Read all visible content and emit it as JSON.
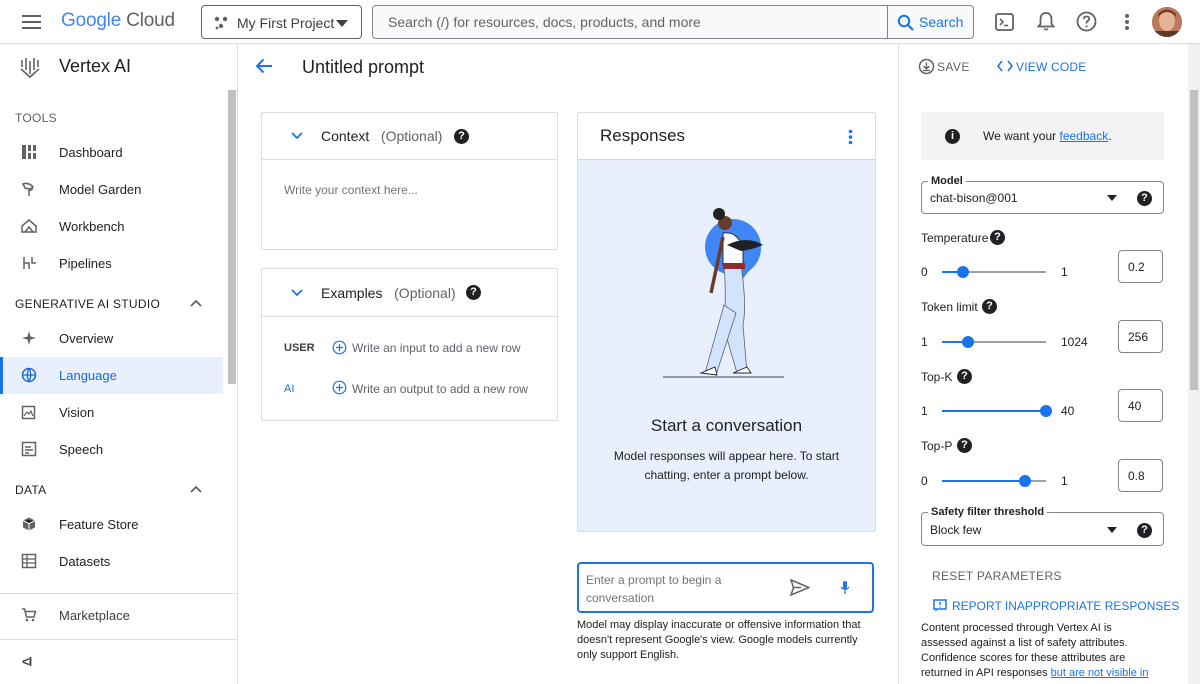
{
  "topbar": {
    "logo_google": "Google",
    "logo_cloud": "Cloud",
    "project": "My First Project",
    "search_placeholder": "Search (/) for resources, docs, products, and more",
    "search_button": "Search"
  },
  "nav": {
    "product": "Vertex AI",
    "tools_header": "TOOLS",
    "tools": [
      {
        "label": "Dashboard",
        "icon": "dashboard-icon"
      },
      {
        "label": "Model Garden",
        "icon": "model-garden-icon"
      },
      {
        "label": "Workbench",
        "icon": "workbench-icon"
      },
      {
        "label": "Pipelines",
        "icon": "pipelines-icon"
      }
    ],
    "genai_header": "GENERATIVE AI STUDIO",
    "genai": [
      {
        "label": "Overview",
        "icon": "sparkle-icon"
      },
      {
        "label": "Language",
        "icon": "language-icon",
        "active": true
      },
      {
        "label": "Vision",
        "icon": "vision-icon"
      },
      {
        "label": "Speech",
        "icon": "speech-icon"
      }
    ],
    "data_header": "DATA",
    "data": [
      {
        "label": "Feature Store",
        "icon": "feature-store-icon"
      },
      {
        "label": "Datasets",
        "icon": "datasets-icon"
      }
    ],
    "marketplace": "Marketplace",
    "collapse_glyph": "<I"
  },
  "main": {
    "title": "Untitled prompt",
    "context": {
      "title": "Context",
      "optional": "(Optional)",
      "placeholder": "Write your context here..."
    },
    "examples": {
      "title": "Examples",
      "optional": "(Optional)",
      "user_label": "USER",
      "user_placeholder": "Write an input to add a new row",
      "ai_label": "AI",
      "ai_placeholder": "Write an output to add a new row"
    },
    "responses": {
      "title": "Responses",
      "empty_title": "Start a conversation",
      "empty_text": "Model responses will appear here. To start chatting, enter a prompt below."
    },
    "prompt": {
      "placeholder": "Enter a prompt to begin a conversation",
      "disclaimer": "Model may display inaccurate or offensive information that doesn't represent Google's view. Google models currently only support English."
    }
  },
  "panel": {
    "save": "SAVE",
    "view_code": "VIEW CODE",
    "feedback_prefix": "We want your ",
    "feedback_link": "feedback",
    "feedback_suffix": ".",
    "model_label": "Model",
    "model_value": "chat-bison@001",
    "temperature": {
      "label": "Temperature",
      "min": "0",
      "max": "1",
      "value": "0.2",
      "fraction": 0.2
    },
    "token_limit": {
      "label": "Token limit",
      "min": "1",
      "max": "1024",
      "value": "256",
      "fraction": 0.25
    },
    "top_k": {
      "label": "Top-K",
      "min": "1",
      "max": "40",
      "value": "40",
      "fraction": 1.0
    },
    "top_p": {
      "label": "Top-P",
      "min": "0",
      "max": "1",
      "value": "0.8",
      "fraction": 0.8
    },
    "safety_label": "Safety filter threshold",
    "safety_value": "Block few",
    "reset": "RESET PARAMETERS",
    "report": "REPORT INAPPROPRIATE RESPONSES",
    "info_text": "Content processed through Vertex AI is assessed against a list of safety attributes. Confidence scores for these attributes are returned in API responses ",
    "info_link": "but are not visible in"
  },
  "colors": {
    "accent": "#1a73e8",
    "illustration_bg": "#e8f0fe"
  }
}
